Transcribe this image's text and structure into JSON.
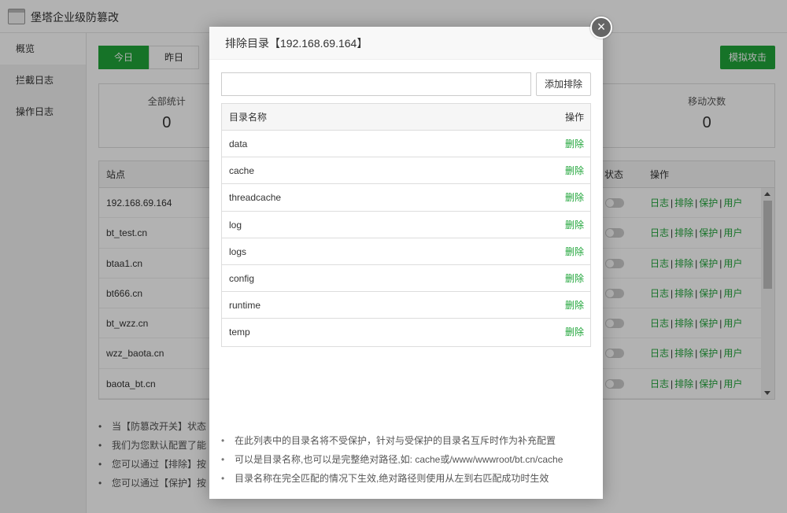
{
  "app": {
    "title": "堡塔企业级防篡改"
  },
  "sidebar": {
    "items": [
      {
        "label": "概览"
      },
      {
        "label": "拦截日志"
      },
      {
        "label": "操作日志"
      }
    ]
  },
  "main": {
    "day_tabs": [
      "今日",
      "昨日"
    ],
    "simulate_button": "模拟攻击",
    "stats": [
      {
        "label": "全部统计",
        "value": "0"
      },
      {
        "label": "移动次数",
        "value": "0"
      }
    ],
    "site_table": {
      "headers": {
        "site": "站点",
        "status": "状态",
        "ops": "操作"
      },
      "op_labels": [
        "日志",
        "排除",
        "保护",
        "用户"
      ],
      "rows": [
        {
          "site": "192.168.69.164"
        },
        {
          "site": "bt_test.cn"
        },
        {
          "site": "btaa1.cn"
        },
        {
          "site": "bt666.cn"
        },
        {
          "site": "bt_wzz.cn"
        },
        {
          "site": "wzz_baota.cn"
        },
        {
          "site": "baota_bt.cn"
        }
      ]
    },
    "notes": [
      "当【防篡改开关】状态",
      "我们为您默认配置了能",
      "您可以通过【排除】按",
      "您可以通过【保护】按"
    ]
  },
  "dialog": {
    "title": "排除目录【192.168.69.164】",
    "input": {
      "value": "",
      "placeholder": ""
    },
    "add_button": "添加排除",
    "table": {
      "headers": {
        "name": "目录名称",
        "op": "操作"
      },
      "delete_label": "删除",
      "rows": [
        "data",
        "cache",
        "threadcache",
        "log",
        "logs",
        "config",
        "runtime",
        "temp"
      ]
    },
    "notes": [
      "在此列表中的目录名将不受保护，针对与受保护的目录名互斥时作为补充配置",
      "可以是目录名称,也可以是完整绝对路径,如: cache或/www/wwwroot/bt.cn/cache",
      "目录名称在完全匹配的情况下生效,绝对路径则使用从左到右匹配成功时生效"
    ]
  },
  "colors": {
    "accent": "#20a53a",
    "overlay": "rgba(0,0,0,0.3)"
  }
}
